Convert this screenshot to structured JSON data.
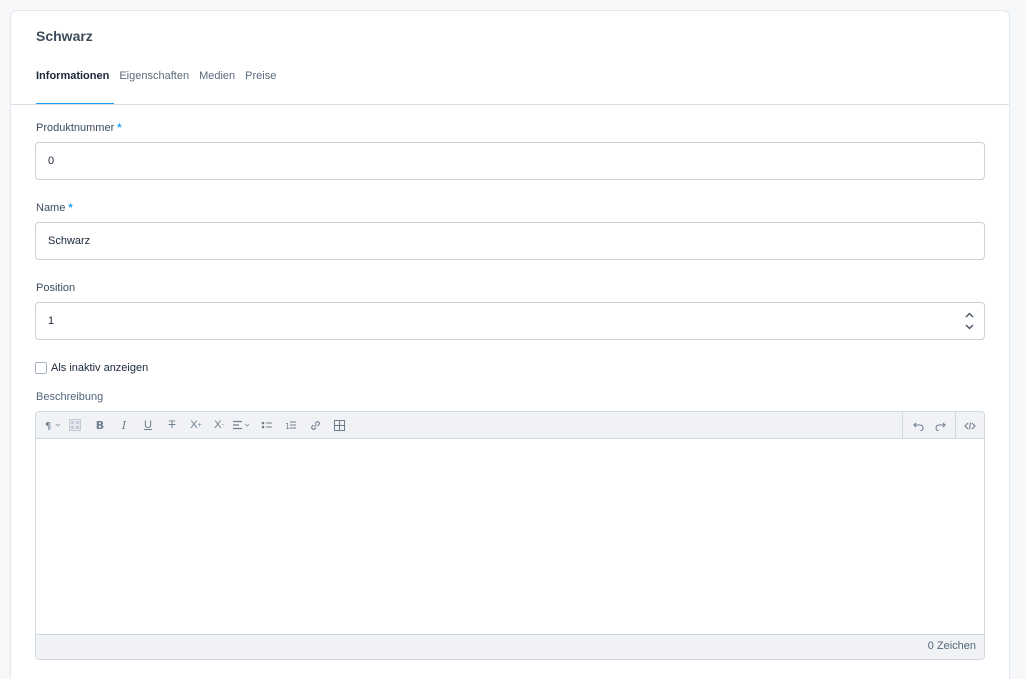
{
  "card": {
    "title": "Schwarz"
  },
  "tabs": [
    {
      "label": "Informationen",
      "active": true
    },
    {
      "label": "Eigenschaften",
      "active": false
    },
    {
      "label": "Medien",
      "active": false
    },
    {
      "label": "Preise",
      "active": false
    }
  ],
  "fields": {
    "product_number": {
      "label": "Produktnummer",
      "required": "*",
      "value": "0"
    },
    "name": {
      "label": "Name",
      "required": "*",
      "value": "Schwarz"
    },
    "position": {
      "label": "Position",
      "value": "1"
    }
  },
  "inactive_checkbox": {
    "label": "Als inaktiv anzeigen",
    "checked": false
  },
  "description": {
    "label": "Beschreibung",
    "char_count": "0 Zeichen",
    "toolbar_icons": [
      "paragraph-format-icon",
      "text-color-icon",
      "bold-icon",
      "italic-icon",
      "underline-icon",
      "strikethrough-icon",
      "superscript-icon",
      "subscript-icon",
      "align-icon",
      "unordered-list-icon",
      "ordered-list-icon",
      "link-icon",
      "table-icon",
      "undo-icon",
      "redo-icon",
      "code-view-icon"
    ]
  },
  "colors": {
    "accent": "#189eff",
    "text": "#1c2838",
    "muted": "#52667a",
    "border": "#c9d1da"
  }
}
